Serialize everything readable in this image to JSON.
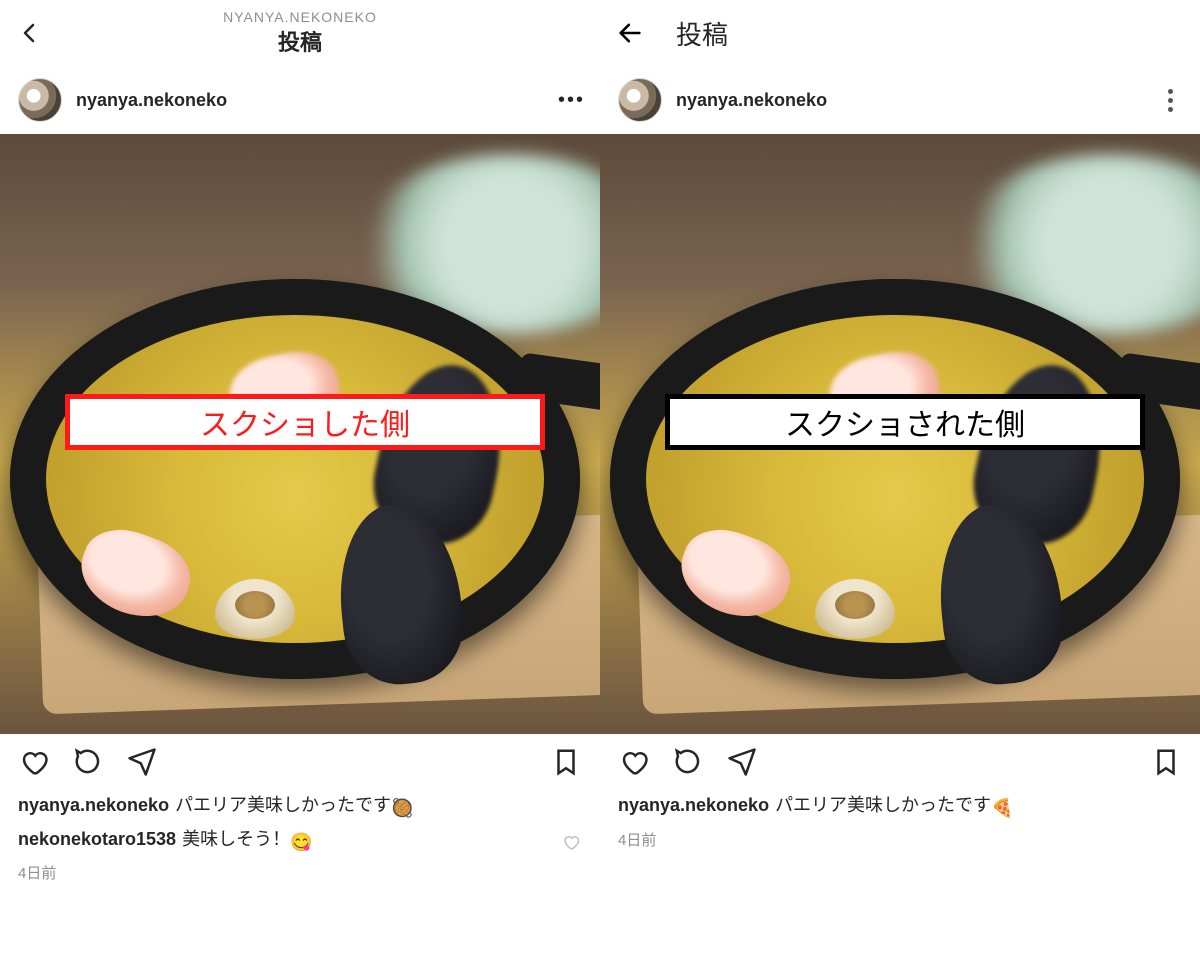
{
  "left": {
    "header": {
      "subtitle": "NYANYA.NEKONEKO",
      "title": "投稿"
    },
    "author": "nyanya.nekoneko",
    "overlay_label": "スクショした側",
    "caption": {
      "user": "nyanya.nekoneko",
      "text": "パエリア美味しかったです",
      "emoji": "🥘"
    },
    "comment": {
      "user": "nekonekotaro1538",
      "text": "美味しそう！",
      "emoji": "😋"
    },
    "timestamp": "4日前"
  },
  "right": {
    "header": {
      "title": "投稿"
    },
    "author": "nyanya.nekoneko",
    "overlay_label": "スクショされた側",
    "caption": {
      "user": "nyanya.nekoneko",
      "text": "パエリア美味しかったです",
      "emoji": "🍕"
    },
    "timestamp": "4日前"
  }
}
